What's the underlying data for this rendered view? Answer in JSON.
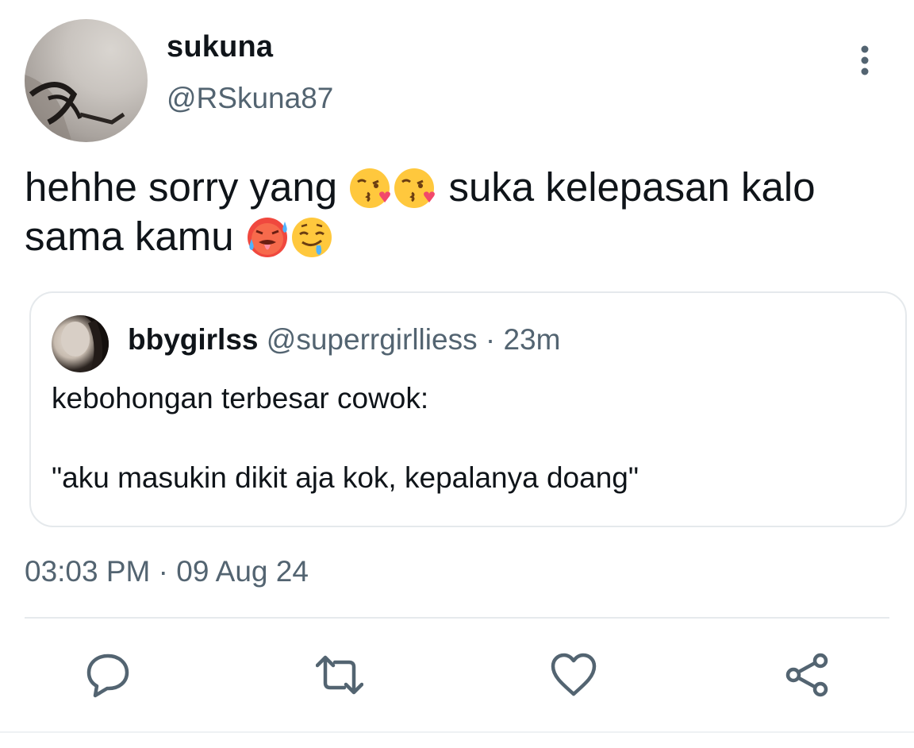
{
  "author": {
    "display_name": "sukuna",
    "handle": "@RSkuna87"
  },
  "tweet": {
    "text_1": "hehhe sorry yang",
    "emoji_1": "face-blowing-a-kiss",
    "emoji_2": "face-blowing-a-kiss",
    "text_2": "suka kelepasan kalo",
    "text_3": "sama kamu",
    "emoji_3": "hot-face",
    "emoji_4": "drooling-face"
  },
  "quoted": {
    "display_name": "bbygirlss",
    "handle": "@superrgirlliess",
    "separator": "·",
    "time_ago": "23m",
    "line_1": "kebohongan terbesar cowok:",
    "line_2": "\"aku masukin dikit aja kok, kepalanya doang\""
  },
  "timestamp": "03:03 PM · 09 Aug 24",
  "actions": {
    "reply_icon": "speech-bubble-icon",
    "retweet_icon": "retweet-icon",
    "like_icon": "heart-icon",
    "share_icon": "share-icon"
  },
  "colors": {
    "text": "#0f1419",
    "secondary": "#536471",
    "border": "#e5e9ec"
  }
}
